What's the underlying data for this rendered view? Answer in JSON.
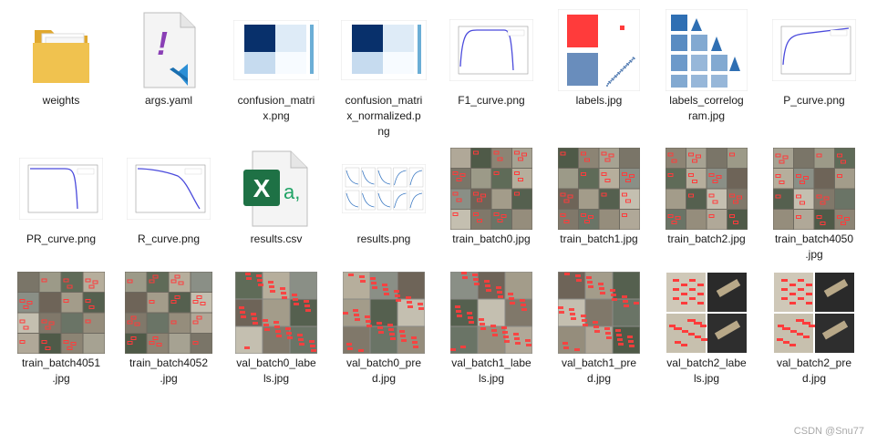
{
  "files": [
    {
      "name": "weights",
      "kind": "folder"
    },
    {
      "name": "args.yaml",
      "kind": "yaml"
    },
    {
      "name": "confusion_matrix.png",
      "kind": "matrix"
    },
    {
      "name": "confusion_matrix_normalized.png",
      "kind": "matrix"
    },
    {
      "name": "F1_curve.png",
      "kind": "plot-f1"
    },
    {
      "name": "labels.jpg",
      "kind": "labels"
    },
    {
      "name": "labels_correlogram.jpg",
      "kind": "correlogram"
    },
    {
      "name": "P_curve.png",
      "kind": "plot-p"
    },
    {
      "name": "PR_curve.png",
      "kind": "plot-pr"
    },
    {
      "name": "R_curve.png",
      "kind": "plot-r"
    },
    {
      "name": "results.csv",
      "kind": "excel"
    },
    {
      "name": "results.png",
      "kind": "results"
    },
    {
      "name": "train_batch0.jpg",
      "kind": "mosaic"
    },
    {
      "name": "train_batch1.jpg",
      "kind": "mosaic"
    },
    {
      "name": "train_batch2.jpg",
      "kind": "mosaic"
    },
    {
      "name": "train_batch4050.jpg",
      "kind": "mosaic"
    },
    {
      "name": "train_batch4051.jpg",
      "kind": "mosaic-tall"
    },
    {
      "name": "train_batch4052.jpg",
      "kind": "mosaic-tall"
    },
    {
      "name": "val_batch0_labels.jpg",
      "kind": "val"
    },
    {
      "name": "val_batch0_pred.jpg",
      "kind": "val"
    },
    {
      "name": "val_batch1_labels.jpg",
      "kind": "val"
    },
    {
      "name": "val_batch1_pred.jpg",
      "kind": "val"
    },
    {
      "name": "val_batch2_labels.jpg",
      "kind": "val2"
    },
    {
      "name": "val_batch2_pred.jpg",
      "kind": "val2"
    }
  ],
  "label_lines": [
    [
      "weights"
    ],
    [
      "args.yaml"
    ],
    [
      "confusion_matri",
      "x.png"
    ],
    [
      "confusion_matri",
      "x_normalized.p",
      "ng"
    ],
    [
      "F1_curve.png"
    ],
    [
      "labels.jpg"
    ],
    [
      "labels_correlog",
      "ram.jpg"
    ],
    [
      "P_curve.png"
    ],
    [
      "PR_curve.png"
    ],
    [
      "R_curve.png"
    ],
    [
      "results.csv"
    ],
    [
      "results.png"
    ],
    [
      "train_batch0.jpg"
    ],
    [
      "train_batch1.jpg"
    ],
    [
      "train_batch2.jpg"
    ],
    [
      "train_batch4050",
      ".jpg"
    ],
    [
      "train_batch4051",
      ".jpg"
    ],
    [
      "train_batch4052",
      ".jpg"
    ],
    [
      "val_batch0_labe",
      "ls.jpg"
    ],
    [
      "val_batch0_pre",
      "d.jpg"
    ],
    [
      "val_batch1_labe",
      "ls.jpg"
    ],
    [
      "val_batch1_pre",
      "d.jpg"
    ],
    [
      "val_batch2_labe",
      "ls.jpg"
    ],
    [
      "val_batch2_pre",
      "d.jpg"
    ]
  ],
  "icons": {
    "excel_letter": "X",
    "excel_suffix": "a,",
    "yaml_glyph": "!"
  },
  "colors": {
    "folder": "#f0c24f",
    "excel": "#1e7145",
    "vscode": "#2c8fd6",
    "yaml": "#8a3fb5",
    "box": "#ff3b3b",
    "plot_line": "#4b4bdc"
  },
  "watermark": "CSDN @Snu77"
}
